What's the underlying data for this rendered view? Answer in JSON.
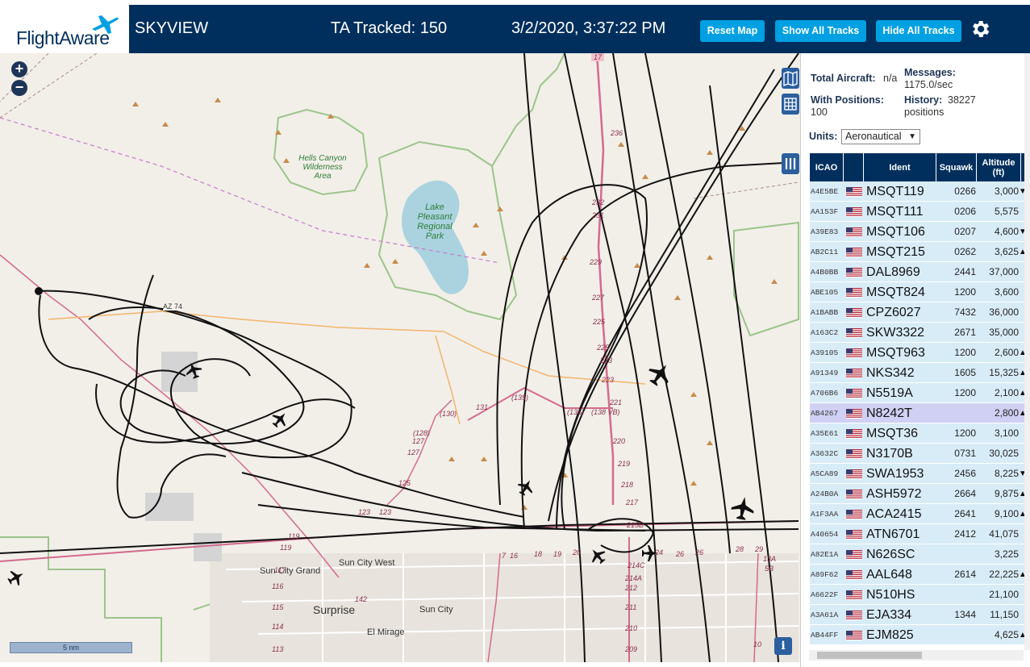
{
  "header": {
    "logo_text": "FlightAware",
    "app_title": "SKYVIEW",
    "ta_tracked": "TA Tracked: 150",
    "datetime": "3/2/2020, 3:37:22 PM",
    "buttons": {
      "reset_map": "Reset Map",
      "show_all_tracks": "Show All Tracks",
      "hide_all_tracks": "Hide All Tracks"
    },
    "settings_icon": "gear-icon"
  },
  "map": {
    "zoom_in": "+",
    "zoom_out": "−",
    "scale_label": "5 nm",
    "info_label": "i",
    "labels": {
      "hells_canyon": "Hells Canyon Wilderness Area",
      "lake_pleasant": "Lake Pleasant Regional Park",
      "az74": "AZ 74",
      "sun_city_west": "Sun City West",
      "sun_city_grand": "Sun City Grand",
      "surprise": "Surprise",
      "sun_city": "Sun City",
      "el_mirage": "El Mirage",
      "r17": "17",
      "r236": "236",
      "r232": "232",
      "r231": "231",
      "r229": "229",
      "r227": "227",
      "r225": "225",
      "r223": "223",
      "r221": "221",
      "r220": "220",
      "r219": "219",
      "r218": "218",
      "r217": "217",
      "r215b": "215B",
      "r214c": "214C",
      "r214a": "214A",
      "r212": "212",
      "r211": "211",
      "r210": "210",
      "r209": "209",
      "r135": "(135)",
      "r136": "(136)",
      "r138": "(138 VB)",
      "r131": "131",
      "r130": "(130)",
      "r128": "(128)",
      "r127": "127",
      "r127b": "127",
      "r125": "125",
      "r123": "123",
      "r123b": "123",
      "r119": "119",
      "r119b": "119",
      "r117": "117",
      "r116": "116",
      "r115": "115",
      "r114": "114",
      "r113": "113",
      "r142": "142",
      "r16": "16",
      "r18": "18",
      "r19": "19",
      "r20": "20",
      "r24": "24",
      "r26": "26",
      "r26b": "26",
      "r28": "28",
      "r29": "29",
      "r13a": "13A",
      "r5b": "5B",
      "r10": "10",
      "r7": "7"
    }
  },
  "panel": {
    "total_aircraft_label": "Total Aircraft:",
    "total_aircraft_value": "n/a",
    "messages_label": "Messages:",
    "messages_value": "1175.0/sec",
    "with_positions_label": "With Positions:",
    "with_positions_value": "100",
    "history_label": "History:",
    "history_value": "38227",
    "history_unit": "positions",
    "units_label": "Units:",
    "units_value": "Aeronautical",
    "columns": {
      "icao": "ICAO",
      "ident": "Ident",
      "squawk": "Squawk",
      "altitude": "Altitude (ft)"
    },
    "rows": [
      {
        "icao": "A4E5BE",
        "ident": "MSQT119",
        "squawk": "0266",
        "alt": "3,000",
        "trend": "▼"
      },
      {
        "icao": "AA153F",
        "ident": "MSQT111",
        "squawk": "0206",
        "alt": "5,575",
        "trend": ""
      },
      {
        "icao": "A39E83",
        "ident": "MSQT106",
        "squawk": "0207",
        "alt": "4,600",
        "trend": "▼"
      },
      {
        "icao": "AB2C11",
        "ident": "MSQT215",
        "squawk": "0262",
        "alt": "3,625",
        "trend": "▲"
      },
      {
        "icao": "A4B0BB",
        "ident": "DAL8969",
        "squawk": "2441",
        "alt": "37,000",
        "trend": ""
      },
      {
        "icao": "ABE105",
        "ident": "MSQT824",
        "squawk": "1200",
        "alt": "3,600",
        "trend": ""
      },
      {
        "icao": "A1BABB",
        "ident": "CPZ6027",
        "squawk": "7432",
        "alt": "36,000",
        "trend": ""
      },
      {
        "icao": "A163C2",
        "ident": "SKW3322",
        "squawk": "2671",
        "alt": "35,000",
        "trend": ""
      },
      {
        "icao": "A39105",
        "ident": "MSQT963",
        "squawk": "1200",
        "alt": "2,600",
        "trend": "▲"
      },
      {
        "icao": "A91349",
        "ident": "NKS342",
        "squawk": "1605",
        "alt": "15,325",
        "trend": "▲"
      },
      {
        "icao": "A706B6",
        "ident": "N5519A",
        "squawk": "1200",
        "alt": "2,100",
        "trend": "▲"
      },
      {
        "icao": "AB4267",
        "ident": "N8242T",
        "squawk": "",
        "alt": "2,800",
        "trend": "▲"
      },
      {
        "icao": "A35E61",
        "ident": "MSQT36",
        "squawk": "1200",
        "alt": "3,100",
        "trend": ""
      },
      {
        "icao": "A3632C",
        "ident": "N3170B",
        "squawk": "0731",
        "alt": "30,025",
        "trend": ""
      },
      {
        "icao": "A5CA89",
        "ident": "SWA1953",
        "squawk": "2456",
        "alt": "8,225",
        "trend": "▼"
      },
      {
        "icao": "A24B0A",
        "ident": "ASH5972",
        "squawk": "2664",
        "alt": "9,875",
        "trend": "▲"
      },
      {
        "icao": "A1F3AA",
        "ident": "ACA2415",
        "squawk": "2641",
        "alt": "9,100",
        "trend": "▲"
      },
      {
        "icao": "A40654",
        "ident": "ATN6701",
        "squawk": "2412",
        "alt": "41,075",
        "trend": ""
      },
      {
        "icao": "A82E1A",
        "ident": "N626SC",
        "squawk": "",
        "alt": "3,225",
        "trend": ""
      },
      {
        "icao": "A89F62",
        "ident": "AAL648",
        "squawk": "2614",
        "alt": "22,225",
        "trend": "▲"
      },
      {
        "icao": "A6622F",
        "ident": "N510HS",
        "squawk": "",
        "alt": "21,100",
        "trend": ""
      },
      {
        "icao": "A3A61A",
        "ident": "EJA334",
        "squawk": "1344",
        "alt": "11,150",
        "trend": ""
      },
      {
        "icao": "AB44FF",
        "ident": "EJM825",
        "squawk": "",
        "alt": "4,625",
        "trend": "▲"
      }
    ]
  },
  "colors": {
    "header_bg": "#002f5d",
    "button_bg": "#00a0e2",
    "row_bg": "#d8ecf8",
    "row_selected": "#cfd0f3",
    "water": "#aad3df",
    "park_border": "#9cc48a",
    "route": "#d46a8e"
  }
}
